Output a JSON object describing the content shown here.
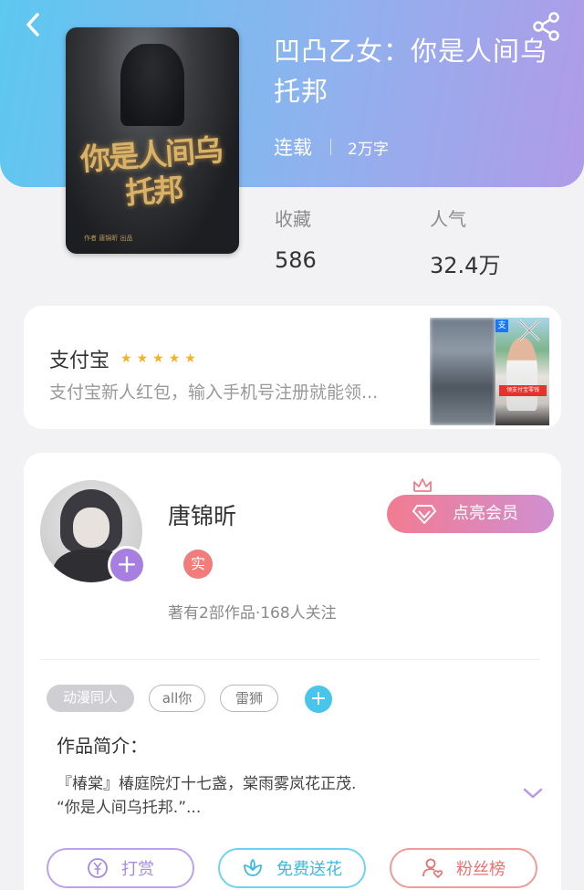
{
  "header": {
    "back_icon": "chevron-left-icon",
    "share_icon": "share-icon",
    "gradient": [
      "#5cc8f0",
      "#b09be8"
    ]
  },
  "book": {
    "cover_title": "你是人间乌托邦",
    "cover_subtitle": "作者 唐锦昕 出品",
    "title": "凹凸乙女：你是人间乌托邦",
    "status": "连载",
    "word_count": "2万字",
    "stats": [
      {
        "label": "收藏",
        "value": "586"
      },
      {
        "label": "人气",
        "value": "32.4万"
      }
    ]
  },
  "ad": {
    "title": "支付宝",
    "rating": 5,
    "description": "支付宝新人红包，输入手机号注册就能领...",
    "badge": "支",
    "caption": "领支付宝零钱",
    "close_icon": "close-icon"
  },
  "author": {
    "name": "唐锦昕",
    "verify_badge": "实",
    "stats": "著有2部作品·168人关注",
    "follow_icon": "plus-icon",
    "vip_label": "点亮会员",
    "vip_icon": "diamond-icon",
    "crown_icon": "crown-icon"
  },
  "tags": [
    {
      "label": "动漫同人",
      "style": "filled"
    },
    {
      "label": "all你",
      "style": "outline"
    },
    {
      "label": "雷狮",
      "style": "outline"
    }
  ],
  "add_tag_icon": "plus-icon",
  "intro": {
    "title": "作品简介：",
    "line1": "『椿棠』椿庭院灯十七盏，棠雨雾岚花正茂.",
    "line2": "“你是人间乌托邦.”...",
    "expand_icon": "chevron-down-icon"
  },
  "actions": [
    {
      "label": "打赏",
      "icon": "yuan-coin-icon",
      "color": "#a58bdf"
    },
    {
      "label": "免费送花",
      "icon": "flower-icon",
      "color": "#3fb8e0"
    },
    {
      "label": "粉丝榜",
      "icon": "user-heart-icon",
      "color": "#e77272"
    }
  ]
}
